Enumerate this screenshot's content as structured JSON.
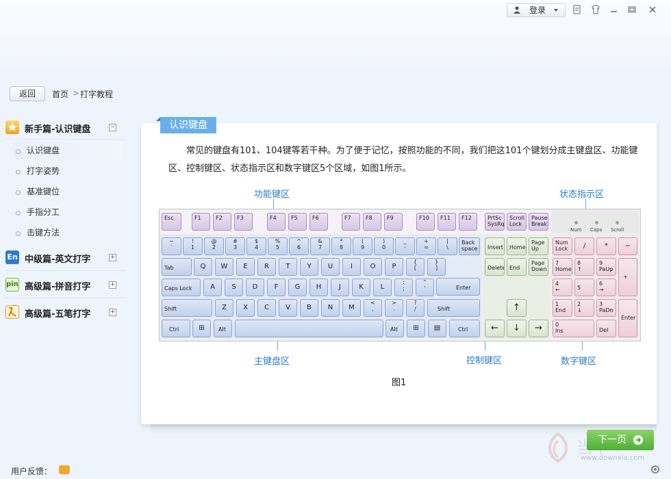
{
  "header": {
    "login_label": "登录",
    "window_buttons": [
      "document-icon",
      "skin-icon",
      "minimize-icon",
      "restore-icon",
      "close-icon"
    ]
  },
  "breadcrumb": {
    "back": "返回",
    "home": "首页",
    "sep": ">",
    "current": "打字教程"
  },
  "sidebar": {
    "sections": [
      {
        "title": "新手篇-认识键盘",
        "icon": "star-icon",
        "toggle": "−",
        "items": [
          "认识键盘",
          "打字姿势",
          "基准键位",
          "手指分工",
          "击键方法"
        ]
      },
      {
        "title": "中级篇-英文打字",
        "icon": "En",
        "toggle": "+"
      },
      {
        "title": "高级篇-拼音打字",
        "icon": "pin",
        "toggle": "+"
      },
      {
        "title": "高级篇-五笔打字",
        "icon": "wubi-icon",
        "toggle": "+"
      }
    ]
  },
  "content": {
    "tag": "认识键盘",
    "paragraph": "常见的键盘有101、104键等若干种。为了便于记忆，按照功能的不同，我们把这101个键划分成主键盘区、功能键区、控制键区、状态指示区和数字键区5个区域，如图1所示。",
    "labels": {
      "func": "功能键区",
      "status": "状态指示区",
      "main": "主键盘区",
      "control": "控制键区",
      "numpad": "数字键区"
    },
    "figure": "图1",
    "leds": [
      "Num",
      "Caps",
      "Scroll"
    ]
  },
  "footer": {
    "feedback": "用户反馈：",
    "next": "下一页",
    "watermark": "当下",
    "watermark_url": "www.downxia.com"
  },
  "colors": {
    "accent": "#6ab0e8",
    "link": "#2b7dc9",
    "next": "#5cb83e"
  }
}
